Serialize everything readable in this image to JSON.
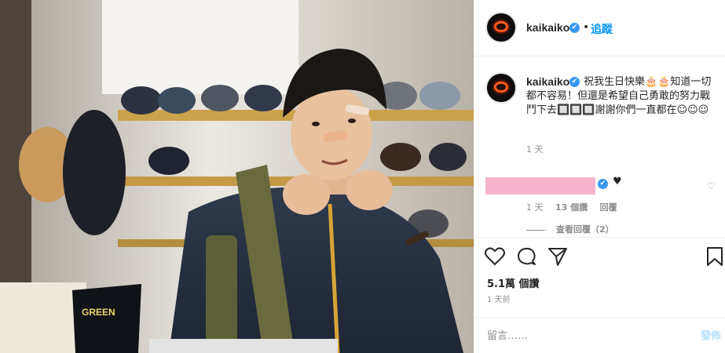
{
  "post": {
    "username": "kaikaiko",
    "verified_badge": "✔",
    "follow_separator": "•",
    "follow_label": "追蹤",
    "caption_text": "祝我生日快樂🎂🎂知道一切都不容易！但還是希望自己勇敢的努力戰鬥下去🔲🔲🔲謝謝你們一直都在☺☺☺",
    "caption_time": "1 天"
  },
  "comment": {
    "heart_symbol": "♥",
    "like_icon": "♡",
    "time": "1 天",
    "likes": "13 個讚",
    "reply_label": "回覆",
    "view_replies": "查看回覆（2）"
  },
  "actions": {
    "likes_count": "5.1萬 個讚",
    "posted": "1 天前"
  },
  "composer": {
    "placeholder": "留言……",
    "post_label": "發佈"
  },
  "photo": {
    "sign_text": "GREEN"
  },
  "colors": {
    "accent": "#0095f6",
    "verified": "#3897f0",
    "muted": "#8e8e8e",
    "redact": "#f7b4cd"
  },
  "icons": [
    "heart-icon",
    "comment-icon",
    "share-icon",
    "bookmark-icon",
    "verified-icon",
    "heart-outline-icon"
  ]
}
